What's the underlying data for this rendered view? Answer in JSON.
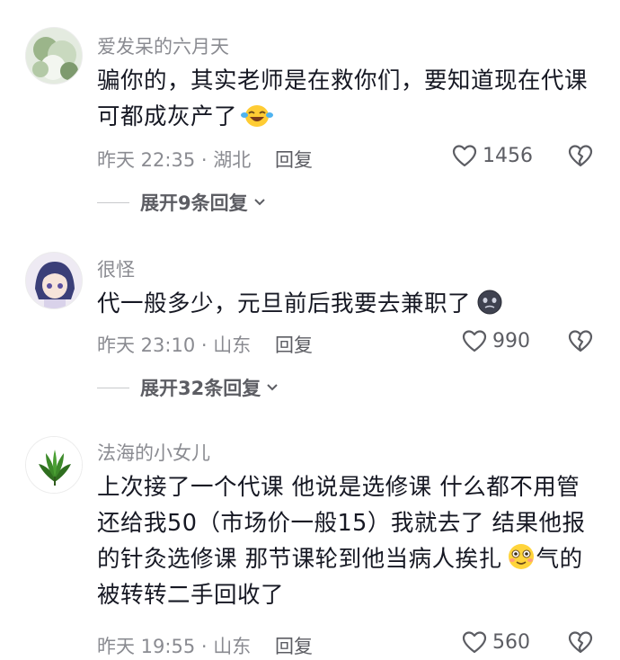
{
  "comments": [
    {
      "username": "爱发呆的六月天",
      "lines": [
        "骗你的，其实老师是在救你们，要知道现在代课",
        "可都成灰产了"
      ],
      "emoji": "laughing-tears",
      "time": "昨天 22:35",
      "location": "湖北",
      "reply_label": "回复",
      "likes": "1456",
      "expand_label": "展开9条回复"
    },
    {
      "username": "很怪",
      "lines": [
        "代一般多少，元旦前后我要去兼职了"
      ],
      "emoji": "dark-face",
      "time": "昨天 23:10",
      "location": "山东",
      "reply_label": "回复",
      "likes": "990",
      "expand_label": "展开32条回复"
    },
    {
      "username": "法海的小女儿",
      "lines": [
        "上次接了一个代课 他说是选修课 什么都不用管",
        "还给我50（市场价一般15）我就去了 结果他报",
        "的针灸选修课 那节课轮到他当病人挨扎",
        "被转转二手回收了"
      ],
      "line3_suffix": "气的",
      "emoji": "smile-blush",
      "time": "昨天 19:55",
      "location": "山东",
      "reply_label": "回复",
      "likes": "560"
    }
  ],
  "colors": {
    "text": "#161823",
    "muted": "#8a8b91",
    "action": "#5c5d63"
  }
}
